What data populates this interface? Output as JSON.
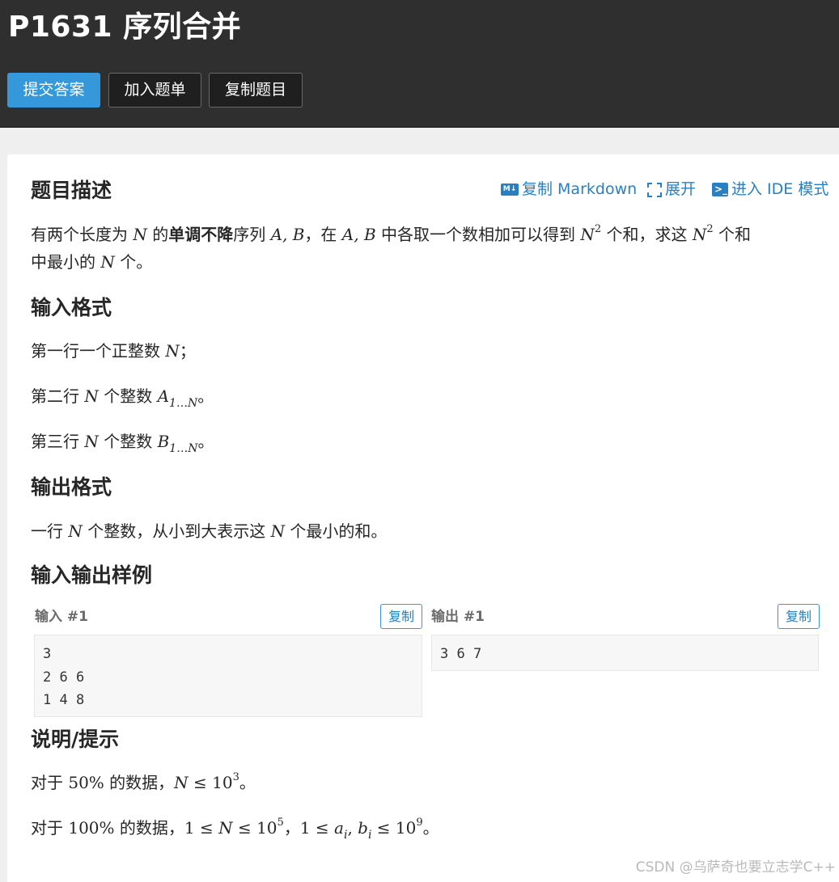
{
  "header": {
    "title": "P1631 序列合并",
    "buttons": {
      "submit": "提交答案",
      "add_to_list": "加入题单",
      "copy_problem": "复制题目"
    }
  },
  "toolbar": {
    "copy_markdown": "复制 Markdown",
    "expand": "展开",
    "ide_mode": "进入 IDE 模式",
    "md_icon_text": "M↓",
    "ide_icon_text": ">_"
  },
  "sections": {
    "description": {
      "heading": "题目描述",
      "line1_a": "有两个长度为 ",
      "var_N": "N",
      "line1_b": " 的",
      "bold": "单调不降",
      "line1_c": "序列 ",
      "var_AB": "A, B",
      "line1_d": "，在 ",
      "line1_e": " 中各取一个数相加可以得到 ",
      "sup_2": "2",
      "line1_f": " 个和，求这 ",
      "line1_g": " 个和",
      "line2_a": "中最小的 ",
      "line2_b": " 个。"
    },
    "input_format": {
      "heading": "输入格式",
      "l1_a": "第一行一个正整数 ",
      "l1_b": "；",
      "l2_a": "第二行 ",
      "l2_b": " 个整数 ",
      "var_A": "A",
      "sub_range": "1…N",
      "l2_c": "。",
      "l3_a": "第三行 ",
      "l3_b": " 个整数 ",
      "var_B": "B",
      "l3_c": "。"
    },
    "output_format": {
      "heading": "输出格式",
      "l1_a": "一行 ",
      "l1_b": " 个整数，从小到大表示这 ",
      "l1_c": " 个最小的和。"
    },
    "samples": {
      "heading": "输入输出样例",
      "input_label": "输入 #1",
      "output_label": "输出 #1",
      "copy_label": "复制",
      "input_text": "3\n2 6 6\n1 4 8",
      "output_text": "3 6 7"
    },
    "hint": {
      "heading": "说明/提示",
      "l1_a": "对于 ",
      "pct50": "50%",
      "l1_b": " 的数据，",
      "l1_c": " ≤ 10",
      "exp3": "3",
      "l1_d": "。",
      "l2_a": "对于 ",
      "pct100": "100%",
      "l2_b": " 的数据，",
      "l2_c": "1 ≤ ",
      "l2_d": " ≤ 10",
      "exp5": "5",
      "l2_e": "，",
      "l2_f": "1 ≤ ",
      "var_ai": "a",
      "var_bi": "b",
      "sub_i": "i",
      "comma": ", ",
      "l2_g": " ≤ 10",
      "exp9": "9",
      "l2_h": "。"
    }
  },
  "watermark": "CSDN @乌萨奇也要立志学C++",
  "colors": {
    "header_bg": "#2f2f2f",
    "primary": "#3498db",
    "link": "#2a7fc0",
    "page_bg": "#efefef"
  }
}
